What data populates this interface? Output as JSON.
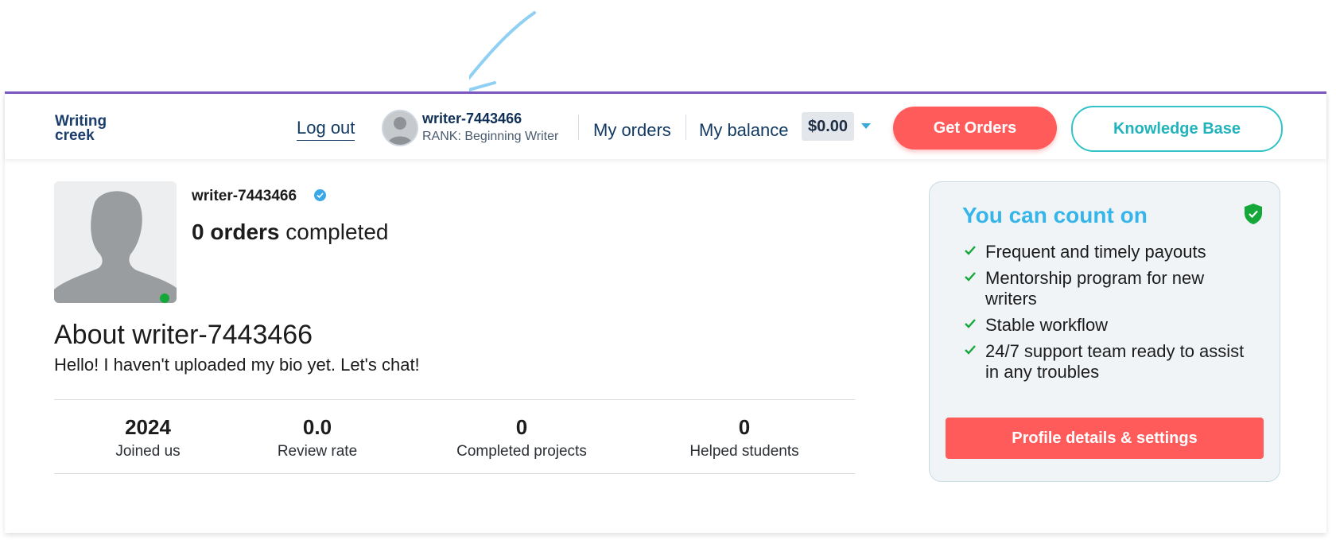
{
  "header": {
    "logo_line1": "Writing",
    "logo_line2": "creek",
    "logout": "Log out",
    "user_name": "writer-7443466",
    "user_rank": "RANK: Beginning Writer",
    "my_orders": "My orders",
    "my_balance": "My balance",
    "balance_value": "$0.00",
    "get_orders": "Get Orders",
    "knowledge_base": "Knowledge Base"
  },
  "profile": {
    "name": "writer-7443466",
    "orders_count": "0 orders",
    "orders_suffix": " completed",
    "about_title": "About writer-7443466",
    "about_text": "Hello! I haven't uploaded my bio yet. Let's chat!"
  },
  "stats": [
    {
      "value": "2024",
      "label": "Joined us"
    },
    {
      "value": "0.0",
      "label": "Review rate"
    },
    {
      "value": "0",
      "label": "Completed projects"
    },
    {
      "value": "0",
      "label": "Helped students"
    }
  ],
  "side_card": {
    "title": "You can count on",
    "benefits": [
      "Frequent and timely payouts",
      "Mentorship program for new writers",
      "Stable workflow",
      "24/7 support team ready to assist in any troubles"
    ],
    "button": "Profile details & settings"
  },
  "colors": {
    "accent_purple": "#7c58c4",
    "primary_red": "#ff5b5b",
    "teal": "#32c3c9",
    "title_blue": "#36b5ea",
    "online_green": "#14a83b"
  },
  "icons": [
    "arrow-annotation-icon",
    "avatar-icon",
    "verified-badge-icon",
    "shield-check-icon",
    "check-icon",
    "caret-down-icon"
  ]
}
